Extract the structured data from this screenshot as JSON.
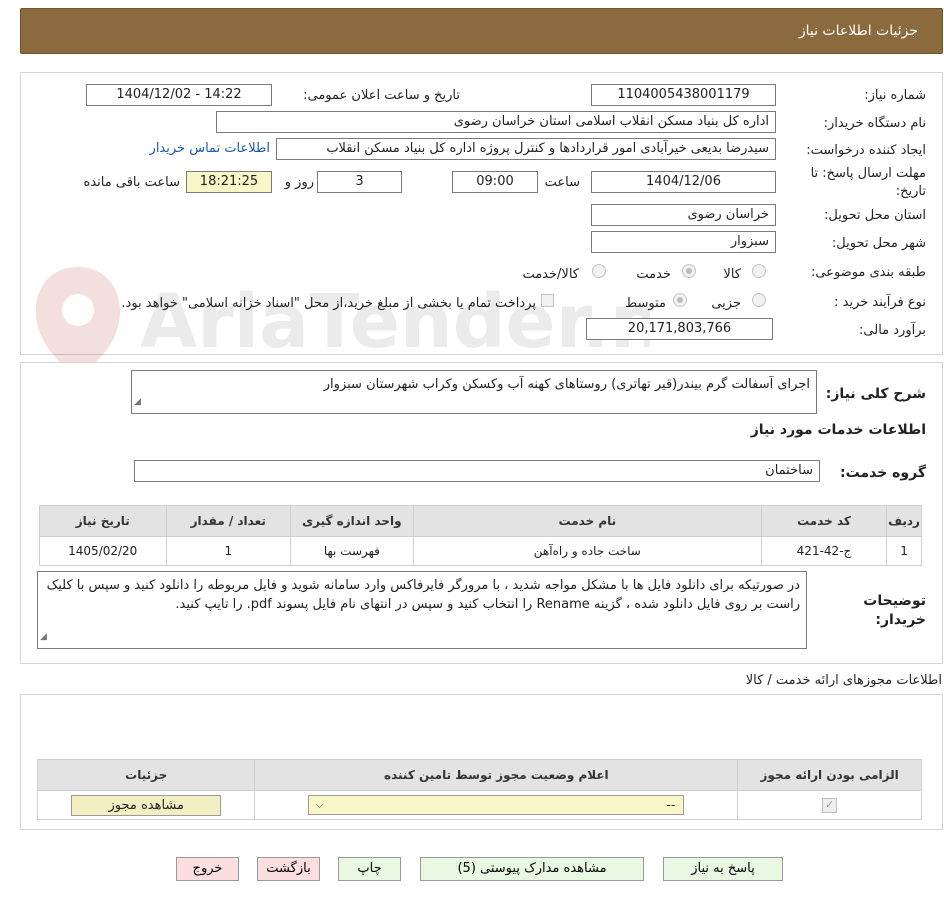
{
  "header": {
    "title": "جزئیات اطلاعات نیاز"
  },
  "watermark": {
    "text": "AriaTender.net"
  },
  "form": {
    "need_number_label": "شماره نیاز:",
    "need_number": "1104005438001179",
    "announce_label": "تاریخ و ساعت اعلان عمومی:",
    "announce_value": "1404/12/02 - 14:22",
    "buyer_org_label": "نام دستگاه خریدار:",
    "buyer_org": "اداره کل بنیاد مسکن انقلاب اسلامی استان خراسان رضوی",
    "creator_label": "ایجاد کننده درخواست:",
    "creator": "سیدرضا بدیعی خیرآبادی امور قراردادها و کنترل پروژه اداره کل بنیاد مسکن انقلاب",
    "contact_link": "اطلاعات تماس خریدار",
    "deadline_label_1": "مهلت ارسال پاسخ: تا",
    "deadline_label_2": "تاریخ:",
    "deadline_date": "1404/12/06",
    "time_label": "ساعت",
    "deadline_time": "09:00",
    "days_value": "3",
    "days_label": "روز و",
    "remaining_time": "18:21:25",
    "remaining_label": "ساعت باقی مانده",
    "province_label": "استان محل تحویل:",
    "province": "خراسان رضوی",
    "city_label": "شهر محل تحویل:",
    "city": "سبزوار",
    "category_label": "طبقه بندی موضوعی:",
    "category_options": [
      "کالا",
      "خدمت",
      "کالا/خدمت"
    ],
    "process_label": "نوع فرآیند خرید :",
    "process_options": [
      "جزیی",
      "متوسط"
    ],
    "payment_note": "پرداخت تمام یا بخشی از مبلغ خرید،از محل \"اسناد خزانه اسلامی\" خواهد بود.",
    "budget_label": "برآورد مالی:",
    "budget": "20,171,803,766"
  },
  "description": {
    "label": "شرح کلی نیاز:",
    "text": "اجرای آسفالت گرم بیندر(قیر تهاتری) روستاهای کهنه آب وکسکن وکراب شهرستان سبزوار"
  },
  "services": {
    "section_title": "اطلاعات خدمات مورد نیاز",
    "group_label": "گروه خدمت:",
    "group_value": "ساختمان",
    "columns": [
      "ردیف",
      "کد خدمت",
      "نام خدمت",
      "واحد اندازه گیری",
      "تعداد / مقدار",
      "تاریخ نیاز"
    ],
    "rows": [
      [
        "1",
        "ج-42-421",
        "ساخت جاده و راه‌آهن",
        "فهرست بها",
        "1",
        "1405/02/20"
      ]
    ]
  },
  "buyer_notes": {
    "label_1": "توضیحات",
    "label_2": "خریدار:",
    "text": "در صورتیکه برای دانلود فایل ها با مشکل مواجه شدید ، با مرورگر فایرفاکس وارد سامانه شوید و فایل مربوطه را دانلود کنید و سپس با کلیک راست بر روی فایل دانلود شده ، گزینه Rename را انتخاب کنید و سپس در انتهای نام فایل پسوند pdf. را تایپ کنید."
  },
  "permits": {
    "section_title": "اطلاعات مجوزهای ارائه خدمت / کالا",
    "columns": [
      "الزامی بودن ارائه مجوز",
      "اعلام وضعیت مجوز توسط تامین کننده",
      "جزئیات"
    ],
    "select_value": "--",
    "view_button": "مشاهده مجوز"
  },
  "actions": {
    "reply": "پاسخ به نیاز",
    "attachments": "مشاهده مدارک پیوستی (5)",
    "print": "چاپ",
    "back": "بازگشت",
    "exit": "خروج"
  }
}
